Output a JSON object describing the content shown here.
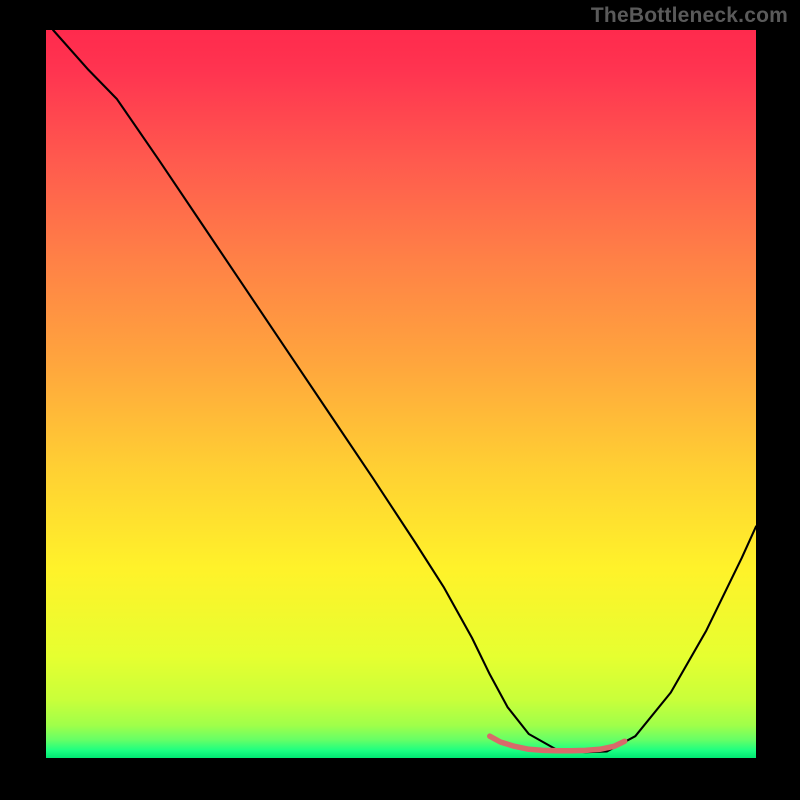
{
  "watermark": "TheBottleneck.com",
  "chart_data": {
    "type": "line",
    "title": "",
    "xlabel": "",
    "ylabel": "",
    "xlim": [
      0,
      100
    ],
    "ylim": [
      0,
      100
    ],
    "grid": false,
    "legend": false,
    "background_gradient": {
      "stops": [
        {
          "offset": 0.0,
          "color": "#ff2a4d"
        },
        {
          "offset": 0.06,
          "color": "#ff3550"
        },
        {
          "offset": 0.18,
          "color": "#ff5a4e"
        },
        {
          "offset": 0.32,
          "color": "#ff8246"
        },
        {
          "offset": 0.46,
          "color": "#ffa63d"
        },
        {
          "offset": 0.6,
          "color": "#ffcf33"
        },
        {
          "offset": 0.74,
          "color": "#fff22a"
        },
        {
          "offset": 0.86,
          "color": "#e6ff30"
        },
        {
          "offset": 0.92,
          "color": "#c9ff3a"
        },
        {
          "offset": 0.955,
          "color": "#a0ff4a"
        },
        {
          "offset": 0.975,
          "color": "#66ff66"
        },
        {
          "offset": 0.99,
          "color": "#1aff82"
        },
        {
          "offset": 1.0,
          "color": "#00e873"
        }
      ]
    },
    "series": [
      {
        "name": "bottleneck-curve",
        "color": "#000000",
        "width": 2.1,
        "x": [
          1,
          6,
          10,
          16,
          22,
          28,
          34,
          40,
          46,
          52,
          56,
          60,
          62.5,
          65,
          68,
          72,
          76,
          79,
          83,
          88,
          93,
          98,
          100
        ],
        "y": [
          100,
          94.5,
          90.5,
          82,
          73.3,
          64.6,
          55.9,
          47.2,
          38.5,
          29.6,
          23.5,
          16.5,
          11.5,
          7,
          3.3,
          1.1,
          0.8,
          0.9,
          3.0,
          9.0,
          17.5,
          27.5,
          31.8
        ]
      },
      {
        "name": "optimal-band",
        "color": "#d86a6a",
        "width": 5.5,
        "cap": "round",
        "x": [
          62.5,
          64,
          66,
          68,
          70,
          72,
          74,
          76,
          78,
          80,
          81.5
        ],
        "y": [
          3.0,
          2.2,
          1.6,
          1.2,
          1.05,
          1.0,
          1.0,
          1.05,
          1.2,
          1.6,
          2.3
        ]
      }
    ]
  }
}
